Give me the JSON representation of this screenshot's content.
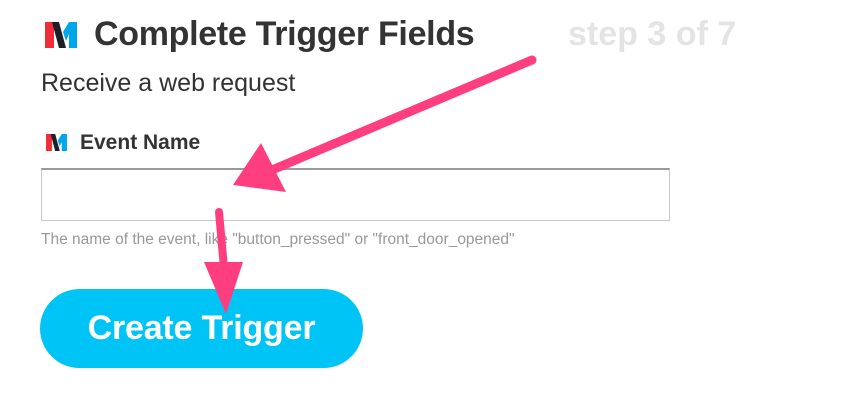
{
  "header": {
    "title": "Complete Trigger Fields",
    "step": "step 3 of 7",
    "logo_icon": "maker-channel-logo-icon"
  },
  "trigger": {
    "name": "Receive a web request"
  },
  "field": {
    "label": "Event Name",
    "value": "",
    "placeholder": "",
    "help": "The name of the event, like \"button_pressed\" or \"front_door_opened\""
  },
  "actions": {
    "create_label": "Create Trigger"
  },
  "colors": {
    "button": "#00c4f5",
    "arrow": "#ff3e7f",
    "logo_red": "#f02c3a",
    "logo_blue": "#00a6ea",
    "logo_dark": "#1e1e28"
  }
}
